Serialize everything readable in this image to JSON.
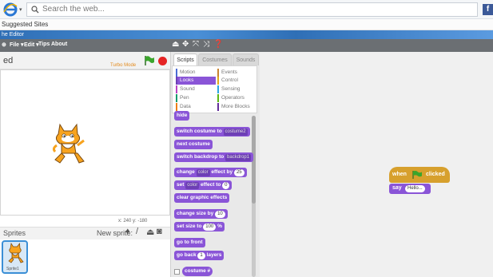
{
  "browser": {
    "search_placeholder": "Search the web...",
    "favorites_label": "Suggested Sites",
    "tab_title": "he Editor",
    "facebook_icon": "f",
    "dropdown_glyph": "▾"
  },
  "menu": {
    "logo": "",
    "file": "File ▾",
    "edit": "Edit ▾",
    "tips": "Tips",
    "about": "About"
  },
  "stage": {
    "project_name": "ed",
    "mode_label": "Turbo Mode",
    "mouse_coords": "x: 240  y: -180"
  },
  "sprites": {
    "title": "Sprites",
    "new_sprite_label": "New sprite:",
    "items": [
      {
        "name": "Sprite1"
      }
    ]
  },
  "tabs": {
    "scripts": "Scripts",
    "costumes": "Costumes",
    "sounds": "Sounds"
  },
  "categories": [
    {
      "label": "Motion",
      "color": "#4a6cd4"
    },
    {
      "label": "Events",
      "color": "#c88330"
    },
    {
      "label": "Looks",
      "color": "#8a55d7"
    },
    {
      "label": "Control",
      "color": "#e1a91a"
    },
    {
      "label": "Sound",
      "color": "#bb42c3"
    },
    {
      "label": "Sensing",
      "color": "#2ca5e2"
    },
    {
      "label": "Pen",
      "color": "#0e9a6c"
    },
    {
      "label": "Operators",
      "color": "#5cb712"
    },
    {
      "label": "Data",
      "color": "#ee7d16"
    },
    {
      "label": "More Blocks",
      "color": "#632d99"
    }
  ],
  "blocks": {
    "hide": "hide",
    "switch_costume": "switch costume to",
    "costume2": "costume2",
    "next_costume": "next costume",
    "switch_backdrop": "switch backdrop to",
    "backdrop1": "backdrop1",
    "change_effect": "change",
    "color": "color",
    "effect_by": "effect by",
    "v25": "25",
    "set": "set",
    "effect_to": "effect to",
    "v0": "0",
    "clear_effects": "clear graphic effects",
    "change_size": "change size by",
    "v10": "10",
    "set_size": "set size to",
    "v100": "100",
    "pct": "%",
    "go_front": "go to front",
    "go_back": "go back",
    "v1": "1",
    "layers": "layers",
    "costume_num": "costume #"
  },
  "script": {
    "when": "when",
    "clicked": "clicked",
    "say": "say",
    "say_value": "Hello..."
  },
  "colors": {
    "looks": "#8a55d7",
    "events": "#d7a02d",
    "menu_bar": "#6b6f73",
    "stop": "#e52323",
    "flag": "#3ba52c"
  }
}
